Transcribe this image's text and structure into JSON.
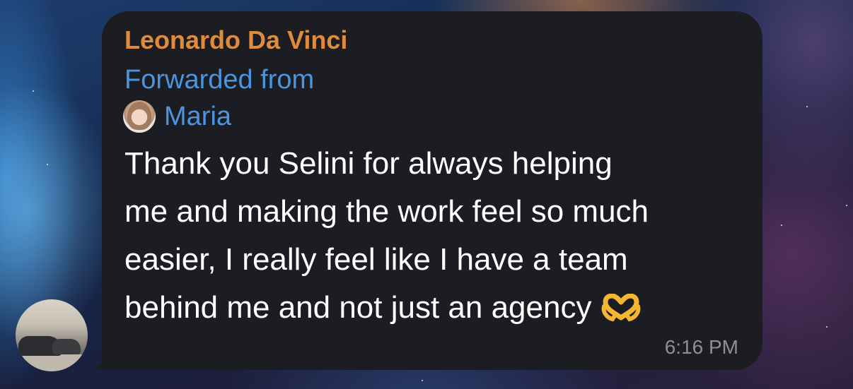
{
  "message": {
    "sender_name": "Leonardo Da Vinci",
    "forwarded_label": "Forwarded from",
    "forwarded_from_name": "Maria",
    "text_lines": [
      "Thank you Selini for always helping",
      "me and making the work feel so much",
      "easier, I really feel like I have a team",
      "behind me and not just an agency"
    ],
    "emoji_icon": "heart-hands-icon",
    "time": "6:16 PM"
  },
  "colors": {
    "bubble": "#1c1d22",
    "sender_name": "#e08a3c",
    "link_blue": "#4b94e0",
    "text": "#ffffff",
    "timestamp": "#8e8f94"
  }
}
